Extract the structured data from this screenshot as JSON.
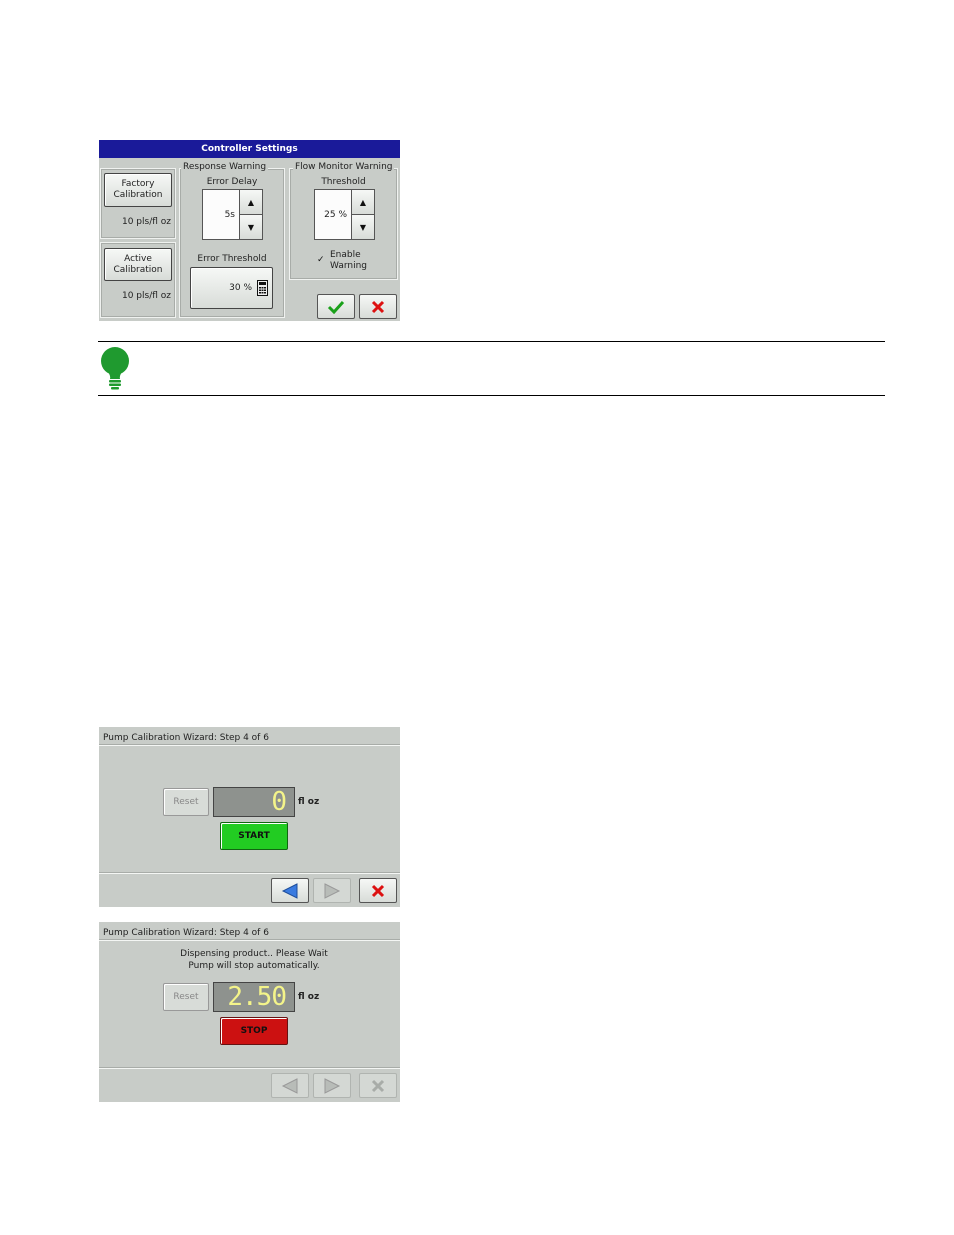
{
  "controller_settings": {
    "title": "Controller Settings",
    "factory_calibration": {
      "button_label": "Factory\nCalibration",
      "value": "10 pls/fl oz"
    },
    "active_calibration": {
      "button_label": "Active\nCalibration",
      "value": "10 pls/fl oz"
    },
    "response_warning": {
      "group_label": "Response Warning",
      "error_delay_label": "Error Delay",
      "error_delay_value": "5s",
      "error_threshold_label": "Error Threshold",
      "error_threshold_value": "30 %"
    },
    "flow_monitor_warning": {
      "group_label": "Flow Monitor Warning",
      "threshold_label": "Threshold",
      "threshold_value": "25 %",
      "enable_warning_label": "Enable\nWarning",
      "enable_warning_checked": true
    }
  },
  "wizard_start": {
    "title": "Pump Calibration Wizard:  Step 4 of 6",
    "reset_label": "Reset",
    "display_value": "0",
    "unit": "fl oz",
    "start_label": "START"
  },
  "wizard_stop": {
    "title": "Pump Calibration Wizard:  Step 4 of 6",
    "message_line1": "Dispensing product.. Please Wait",
    "message_line2": "Pump will stop automatically.",
    "reset_label": "Reset",
    "display_value": "2.50",
    "unit": "fl oz",
    "stop_label": "STOP"
  },
  "colors": {
    "title_bar": "#1a1a99",
    "panel_bg": "#c8ccc8",
    "start_green": "#22cc22",
    "stop_red": "#cc1111",
    "tip_bulb": "#1f9a2f"
  }
}
